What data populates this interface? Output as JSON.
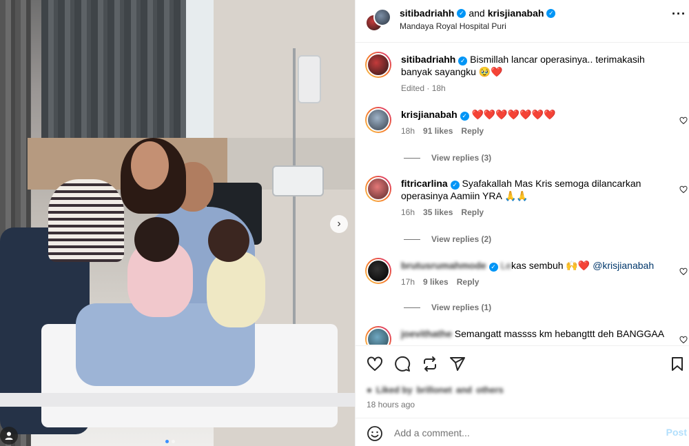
{
  "header": {
    "user1": "sitibadriahh",
    "and": "and",
    "user2": "krisjianabah",
    "location": "Mandaya Royal Hospital Puri",
    "more": "···"
  },
  "caption": {
    "user": "sitibadriahh",
    "text": "Bismillah lancar operasinya.. terimakasih banyak sayangku 🥹❤️",
    "meta": "Edited · 18h"
  },
  "comments": [
    {
      "user": "krisjianabah",
      "text": "❤️❤️❤️❤️❤️❤️❤️",
      "time": "18h",
      "likes": "91 likes",
      "reply": "Reply",
      "view_replies": "View replies (3)"
    },
    {
      "user": "fitricarlina",
      "text": "Syafakallah Mas Kris semoga dilancarkan operasinya Aamiin YRA 🙏🙏",
      "time": "16h",
      "likes": "35 likes",
      "reply": "Reply",
      "view_replies": "View replies (2)"
    },
    {
      "user": "brutusrumahmode",
      "text_pre": "kas sembuh 🙌❤️",
      "mention": "@krisjianabah",
      "time": "17h",
      "likes": "9 likes",
      "reply": "Reply",
      "view_replies": "View replies (1)"
    },
    {
      "user": "joevithathe",
      "text": "Semangatt massss km hebangttt deh BANGGAA"
    }
  ],
  "likes_section": {
    "liked_prefix": "Liked by",
    "liked_user": "brillonet",
    "liked_and": "and",
    "liked_others": "others",
    "time_ago": "18 hours ago"
  },
  "add_comment": {
    "placeholder": "Add a comment...",
    "post": "Post"
  },
  "colors": {
    "verified": "#0095f6",
    "heart": "#ed4956",
    "post_disabled": "#b2dffc",
    "mention": "#00376b"
  }
}
